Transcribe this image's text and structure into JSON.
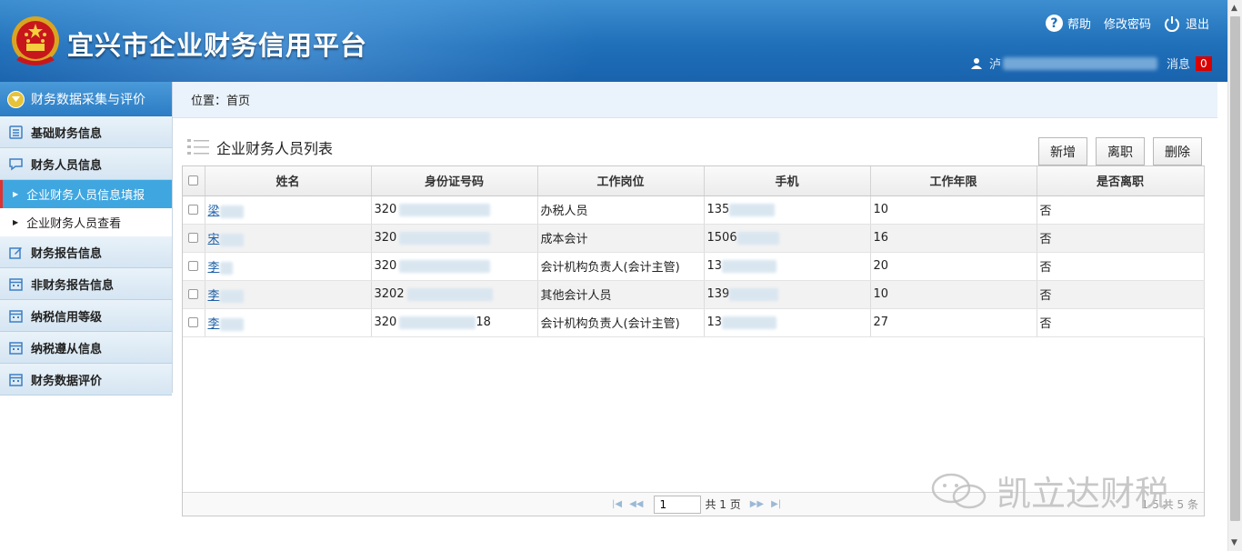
{
  "header": {
    "title": "宜兴市企业财务信用平台",
    "help_label": "帮助",
    "change_password_label": "修改密码",
    "logout_label": "退出",
    "user_prefix": "泸",
    "message_label": "消息",
    "message_count": "0"
  },
  "sidebar": {
    "section_title": "财务数据采集与评价",
    "items": [
      {
        "label": "基础财务信息",
        "icon": "list-icon"
      },
      {
        "label": "财务人员信息",
        "icon": "chat-icon"
      },
      {
        "label": "财务报告信息",
        "icon": "edit-icon"
      },
      {
        "label": "非财务报告信息",
        "icon": "calendar-icon"
      },
      {
        "label": "纳税信用等级",
        "icon": "calendar-icon"
      },
      {
        "label": "纳税遵从信息",
        "icon": "calendar-icon"
      },
      {
        "label": "财务数据评价",
        "icon": "calendar-icon"
      }
    ],
    "subitems": [
      {
        "label": "企业财务人员信息填报",
        "active": true
      },
      {
        "label": "企业财务人员查看",
        "active": false
      }
    ]
  },
  "breadcrumb": {
    "prefix": "位置：",
    "current": "首页"
  },
  "main": {
    "title": "企业财务人员列表",
    "buttons": {
      "add": "新增",
      "leave": "离职",
      "delete": "删除"
    },
    "columns": [
      "姓名",
      "身份证号码",
      "工作岗位",
      "手机",
      "工作年限",
      "是否离职"
    ],
    "rows": [
      {
        "name": "梁",
        "id": "320",
        "post": "办税人员",
        "phone": "135",
        "years": "10",
        "left": "否"
      },
      {
        "name": "宋",
        "id": "320",
        "post": "成本会计",
        "phone": "1506",
        "years": "16",
        "left": "否"
      },
      {
        "name": "李",
        "id": "320",
        "post": "会计机构负责人(会计主管)",
        "phone": "13",
        "years": "20",
        "left": "否"
      },
      {
        "name": "李",
        "id": "3202",
        "post": "其他会计人员",
        "phone": "139",
        "years": "10",
        "left": "否"
      },
      {
        "name": "李",
        "id": "320",
        "post": "会计机构负责人(会计主管)",
        "phone": "13",
        "years": "27",
        "left": "否"
      }
    ],
    "row5_id_suffix": "18",
    "pager": {
      "page": "1",
      "total_pages": "共 1 页",
      "info": "1-5  共 5 条"
    }
  },
  "watermark": "凯立达财税"
}
